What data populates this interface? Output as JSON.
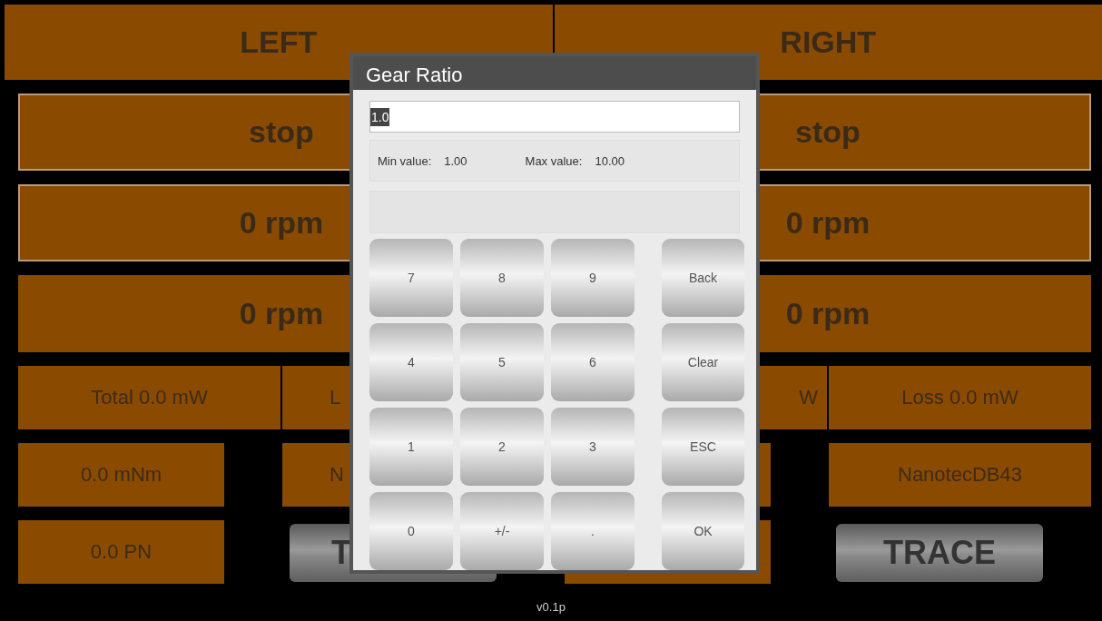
{
  "header": [
    "LEFT",
    "RIGHT"
  ],
  "sides": [
    {
      "big_rows": [
        "stop",
        "0 rpm",
        "0 rpm"
      ],
      "cells": [
        {
          "kind": "value",
          "text": "Total 0.0 mW"
        },
        {
          "kind": "value",
          "text": "L"
        },
        {
          "kind": "value",
          "text": "0.0 mNm"
        },
        {
          "kind": "value",
          "text": "N"
        },
        {
          "kind": "value",
          "text": "0.0 PN"
        },
        {
          "kind": "button",
          "text": "T"
        }
      ]
    },
    {
      "big_rows": [
        "stop",
        "0 rpm",
        "0 rpm"
      ],
      "cells": [
        {
          "kind": "value",
          "text": "W"
        },
        {
          "kind": "value",
          "text": "Loss 0.0 mW"
        },
        {
          "kind": "value"
        },
        {
          "kind": "value",
          "text": "NanotecDB43"
        },
        {
          "kind": "value"
        },
        {
          "kind": "button",
          "text": "TRACE"
        }
      ]
    }
  ],
  "version": "v0.1p",
  "dialog": {
    "title": "Gear Ratio",
    "input": {
      "value": "1.0",
      "selected": true
    },
    "min_label": "Min value:",
    "min_value": "1.00",
    "max_label": "Max value:",
    "max_value": "10.00",
    "digits": [
      "7",
      "8",
      "9",
      "4",
      "5",
      "6",
      "1",
      "2",
      "3",
      "0",
      "+/-",
      "."
    ],
    "actions": [
      "Back",
      "Clear",
      "ESC",
      "OK"
    ]
  }
}
